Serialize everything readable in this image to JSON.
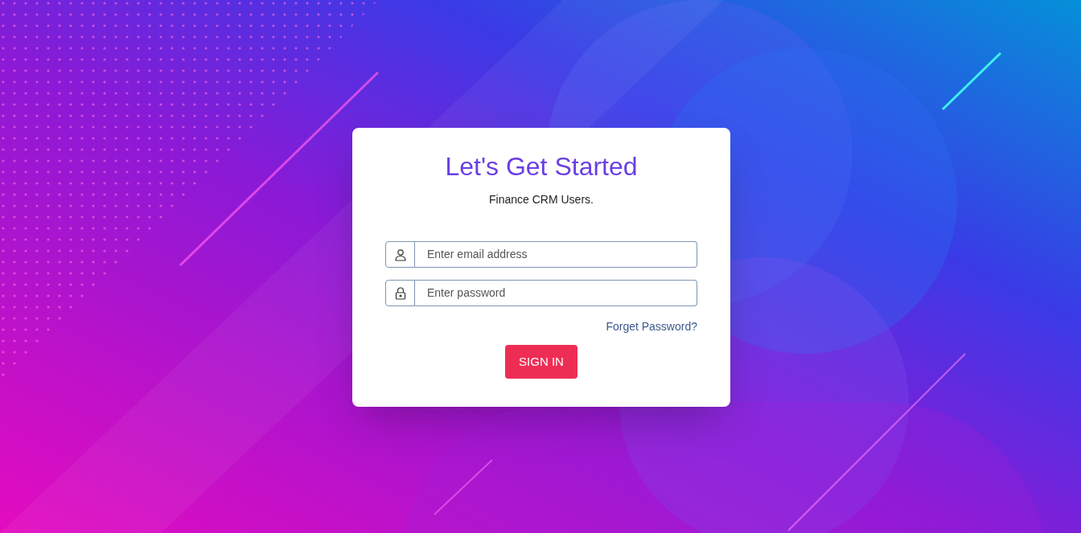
{
  "login_card": {
    "title": "Let's Get Started",
    "subtitle": "Finance CRM Users.",
    "fields": [
      {
        "kind": "email",
        "placeholder": "Enter email address"
      },
      {
        "kind": "password",
        "placeholder": "Enter password"
      }
    ],
    "forgot_link": "Forget Password?",
    "submit_button": "SIGN IN"
  }
}
